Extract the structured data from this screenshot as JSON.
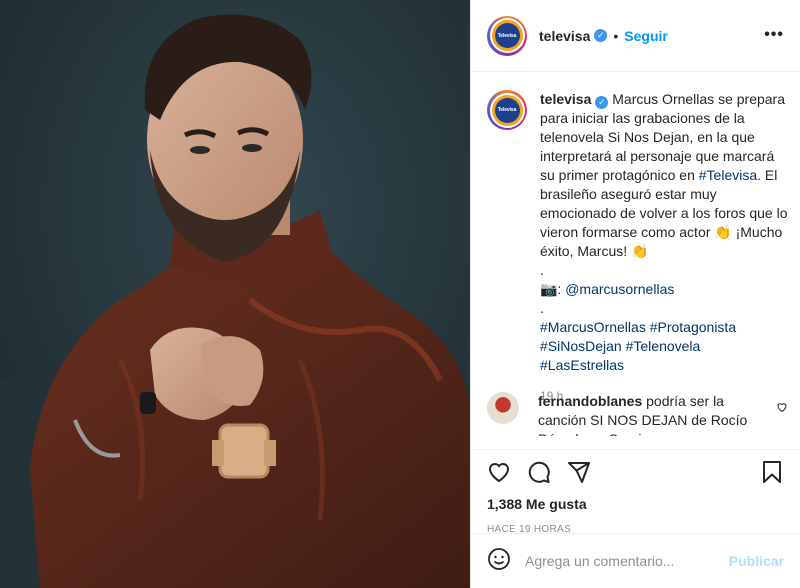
{
  "post": {
    "username": "televisa",
    "follow_label": "Seguir",
    "more_label": "•••",
    "avatar_logo_text": "Televisa",
    "photo_alt": "Retrato de Marcus Ornellas con suéter de cuello alto marrón"
  },
  "caption": {
    "username": "televisa",
    "text_1": "Marcus Ornellas se prepara para iniciar las grabaciones de la telenovela Si Nos Dejan, en la que interpretará al personaje que marcará su primer protagónico en ",
    "hashtag_televisa": "#Televisa",
    "text_2": ". El brasileño aseguró estar muy emocionado de volver a los foros que lo vieron formarse como actor 👏 ¡Mucho éxito, Marcus! 👏",
    "dot_1": ".",
    "camera_emoji": "📷: ",
    "mention": "@marcusornellas",
    "dot_2": ".",
    "hashtags": [
      "#MarcusOrnellas",
      "#Protagonista",
      "#SiNosDejan",
      "#Telenovela",
      "#LasEstrellas"
    ],
    "time": "19 h"
  },
  "comment": {
    "username": "fernandoblanes",
    "text": "podría ser la canción SI NOS DEJAN de Rocío Dúrcal con Sergio"
  },
  "engagement": {
    "likes": "1,388 Me gusta",
    "posted_ago": "HACE 19 HORAS"
  },
  "add_comment": {
    "placeholder": "Agrega un comentario...",
    "publish_label": "Publicar"
  },
  "icons": {
    "like": "heart-icon",
    "comment": "comment-icon",
    "share": "share-icon",
    "save": "bookmark-icon",
    "emoji": "emoji-icon",
    "verified": "verified-badge-icon"
  },
  "colors": {
    "accent": "#0095f6",
    "link": "#00376b",
    "muted": "#8e8e8e",
    "publish_disabled": "#b2dffc"
  }
}
